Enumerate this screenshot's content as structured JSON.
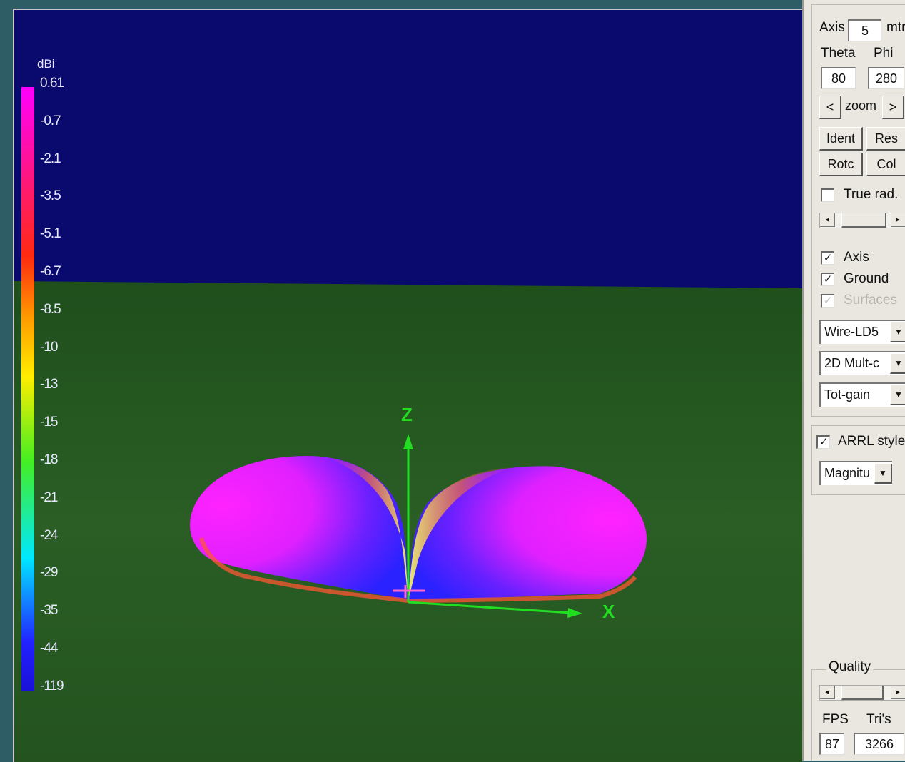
{
  "viewport": {
    "scale": {
      "unit": "dBi",
      "ticks": [
        "0.61",
        "-0.7",
        "-2.1",
        "-3.5",
        "-5.1",
        "-6.7",
        "-8.5",
        "-10",
        "-13",
        "-15",
        "-18",
        "-21",
        "-24",
        "-29",
        "-35",
        "-44",
        "-119"
      ]
    },
    "axes": {
      "z_label": "Z",
      "x_label": "X"
    },
    "colors": {
      "sky": "#0a0a6e",
      "ground": "#245a22",
      "axis": "#22dd22"
    }
  },
  "panel": {
    "axis_label": "Axis",
    "axis_value": "5",
    "axis_unit": "mtr",
    "theta_label": "Theta",
    "phi_label": "Phi",
    "theta_value": "80",
    "phi_value": "280",
    "zoom_prev": "<",
    "zoom_label": "zoom",
    "zoom_next": ">",
    "ident_label": "Ident",
    "res_label": "Res",
    "rotc_label": "Rotc",
    "col_label": "Col",
    "true_rad_label": "True rad.",
    "axis_check_label": "Axis",
    "ground_check_label": "Ground",
    "surfaces_check_label": "Surfaces",
    "check_mark": "✓",
    "dropdown_arrow": "▼",
    "source_select": "Wire-LD5",
    "plot_select": "2D Mult-c",
    "gain_select": "Tot-gain",
    "arrl_label": "ARRL style",
    "magnitude_select": "Magnitu",
    "quality_label": "Quality",
    "fps_label": "FPS",
    "tris_label": "Tri's",
    "fps_value": "87",
    "tris_value": "3266"
  }
}
